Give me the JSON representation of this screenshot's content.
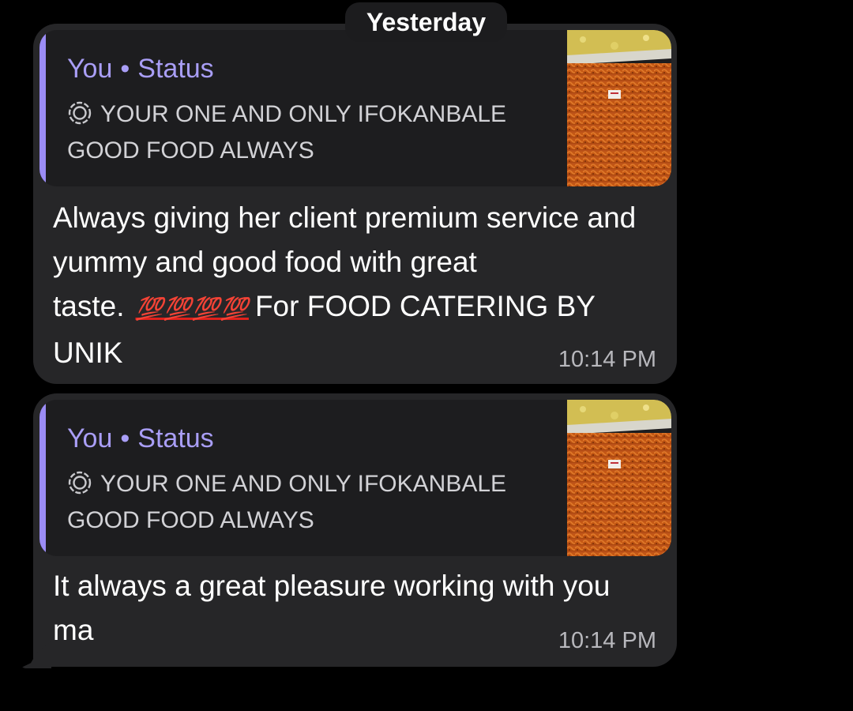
{
  "date_chip": "Yesterday",
  "colors": {
    "background": "#000000",
    "bubble": "#262628",
    "quote_accent": "#9b8cf5",
    "quote_name": "#a99ef6",
    "emoji_red": "#e0201b"
  },
  "messages": [
    {
      "quote": {
        "sender": "You",
        "separator": "•",
        "label": "Status",
        "icon": "status-icon",
        "text": "YOUR ONE AND ONLY IFOKANBALE GOOD FOOD ALWAYS",
        "thumbnail": "food-thumbnail-image"
      },
      "text_part1": "Always giving her client premium service and yummy and good food with great taste.",
      "emoji": "💯💯💯💯",
      "emoji_icon": "hundred-points-icon",
      "text_part2": "For FOOD CATERING BY UNIK",
      "time": "10:14 PM"
    },
    {
      "quote": {
        "sender": "You",
        "separator": "•",
        "label": "Status",
        "icon": "status-icon",
        "text": "YOUR ONE AND ONLY IFOKANBALE GOOD FOOD ALWAYS",
        "thumbnail": "food-thumbnail-image"
      },
      "text": "It always a great pleasure working with you ma",
      "time": "10:14 PM"
    }
  ]
}
